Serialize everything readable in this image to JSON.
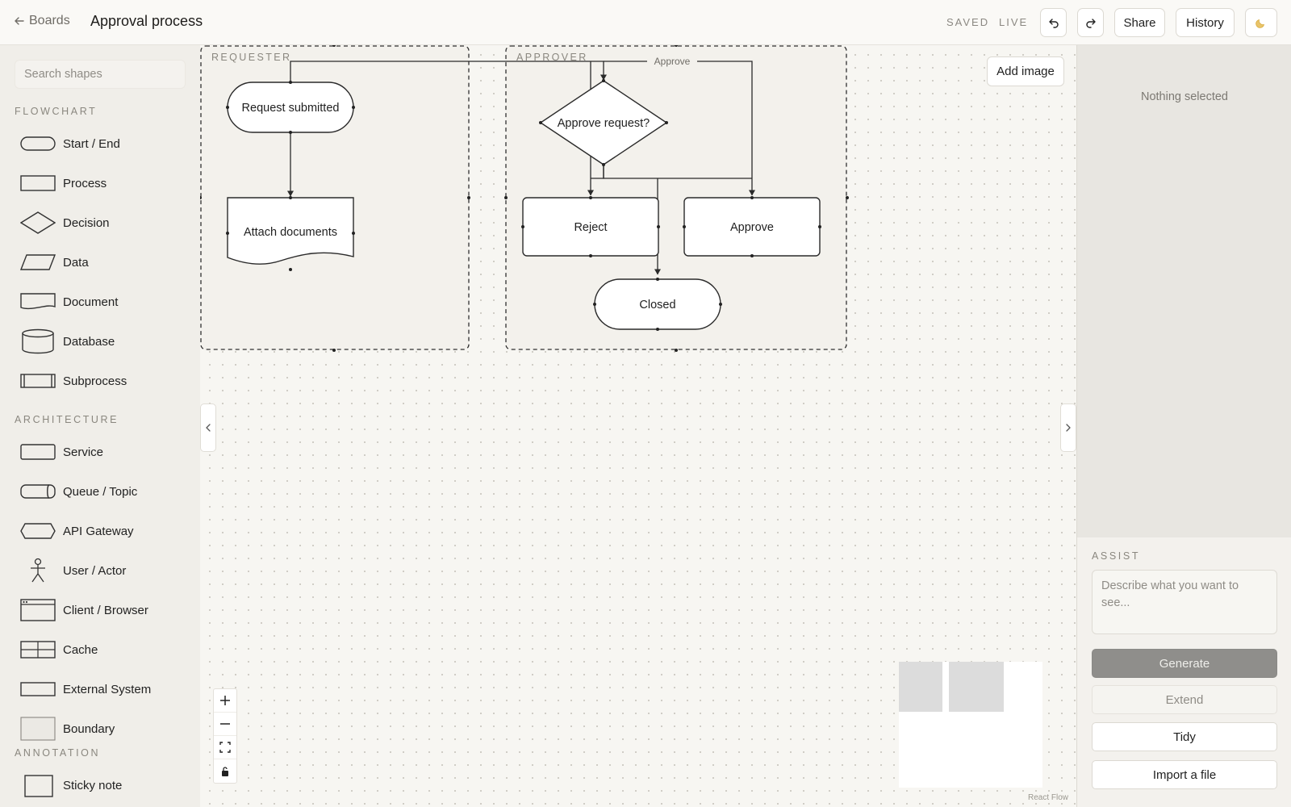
{
  "header": {
    "back_label": "Boards",
    "title": "Approval process",
    "saved": "SAVED",
    "live": "LIVE",
    "share_label": "Share",
    "history_label": "History",
    "undo_icon": "undo-icon",
    "redo_icon": "redo-icon",
    "theme_icon": "moon-icon"
  },
  "sidebar": {
    "search_placeholder": "Search shapes",
    "sections": {
      "flowchart": "FLOWCHART",
      "architecture": "ARCHITECTURE",
      "annotation": "ANNOTATION"
    },
    "flowchart_items": [
      {
        "label": "Start / End",
        "icon": "pill"
      },
      {
        "label": "Process",
        "icon": "rect"
      },
      {
        "label": "Decision",
        "icon": "diamond"
      },
      {
        "label": "Data",
        "icon": "parallelogram"
      },
      {
        "label": "Document",
        "icon": "document"
      },
      {
        "label": "Database",
        "icon": "cylinder"
      },
      {
        "label": "Subprocess",
        "icon": "subprocess"
      }
    ],
    "architecture_items": [
      {
        "label": "Service",
        "icon": "rect"
      },
      {
        "label": "Queue / Topic",
        "icon": "queue"
      },
      {
        "label": "API Gateway",
        "icon": "hexagon"
      },
      {
        "label": "User / Actor",
        "icon": "actor"
      },
      {
        "label": "Client / Browser",
        "icon": "browser"
      },
      {
        "label": "Cache",
        "icon": "grid"
      },
      {
        "label": "External System",
        "icon": "rect"
      },
      {
        "label": "Boundary",
        "icon": "boundary"
      }
    ],
    "annotation_items": [
      {
        "label": "Sticky note",
        "icon": "sticky"
      }
    ]
  },
  "canvas": {
    "add_image_label": "Add image",
    "lanes": {
      "requester": "REQUESTER",
      "approver": "APPROVER"
    },
    "nodes": {
      "request_submitted": "Request submitted",
      "attach_documents": "Attach documents",
      "approve_request": "Approve request?",
      "reject": "Reject",
      "approve": "Approve",
      "closed": "Closed"
    },
    "edge_label_approve": "Approve",
    "attribution": "React Flow",
    "colors": {
      "stroke": "#2a2a2a",
      "node_fill": "#ffffff",
      "lane_fill": "#f3f1ec",
      "dot": "#cdcac3"
    }
  },
  "right_panel": {
    "empty_state": "Nothing selected",
    "assist_label": "ASSIST",
    "prompt_placeholder": "Describe what you want to see...",
    "generate_label": "Generate",
    "extend_label": "Extend",
    "tidy_label": "Tidy",
    "import_label": "Import a file"
  }
}
